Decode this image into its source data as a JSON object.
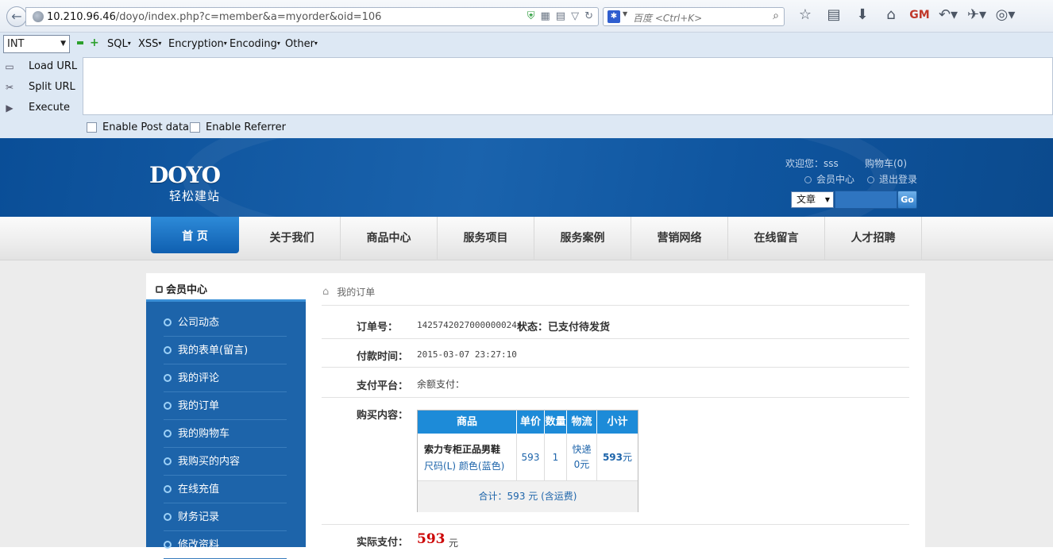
{
  "browser": {
    "url_host": "10.210.96.46",
    "url_path": "/doyo/index.php?c=member&a=myorder&oid=106",
    "search_placeholder": "百度 <Ctrl+K>"
  },
  "hackbar": {
    "int_select": "INT",
    "menus": [
      "SQL",
      "XSS",
      "Encryption",
      "Encoding",
      "Other"
    ],
    "load_url": "Load URL",
    "split_url": "Split URL",
    "execute": "Execute",
    "enable_post": "Enable Post data",
    "enable_referrer": "Enable Referrer"
  },
  "site": {
    "logo": "DOYO",
    "logo_sub": "轻松建站",
    "welcome": "欢迎您：sss",
    "cart": "购物车(0)",
    "member_center": "会员中心",
    "logout": "退出登录",
    "search_type": "文章",
    "search_go": "Go"
  },
  "nav": [
    "首 页",
    "关于我们",
    "商品中心",
    "服务项目",
    "服务案例",
    "营销网络",
    "在线留言",
    "人才招聘"
  ],
  "sidebar": {
    "title": "会员中心",
    "items": [
      "公司动态",
      "我的表单(留言)",
      "我的评论",
      "我的订单",
      "我的购物车",
      "我购买的内容",
      "在线充值",
      "财务记录",
      "修改资料"
    ]
  },
  "main": {
    "breadcrumb": "我的订单",
    "order_no_label": "订单号：",
    "order_no": "14257420270000000244",
    "status_label": "状态：",
    "status": "已支付待发货",
    "pay_time_label": "付款时间：",
    "pay_time": "2015-03-07 23:27:10",
    "platform_label": "支付平台：",
    "platform": "余额支付：",
    "content_label": "购买内容：",
    "table_headers": [
      "商品",
      "单价",
      "数量",
      "物流",
      "小计"
    ],
    "product_name": "索力专柜正品男鞋",
    "product_size": "尺码(L)",
    "product_color": "颜色(蓝色)",
    "unit_price": "593",
    "quantity": "1",
    "shipping_line1": "快递",
    "shipping_line2": "0元",
    "subtotal": "593",
    "subtotal_unit": "元",
    "total_text": "合计：593 元 (含运费)",
    "paid_label": "实际支付：",
    "paid_amount": "593",
    "paid_unit": "元"
  }
}
